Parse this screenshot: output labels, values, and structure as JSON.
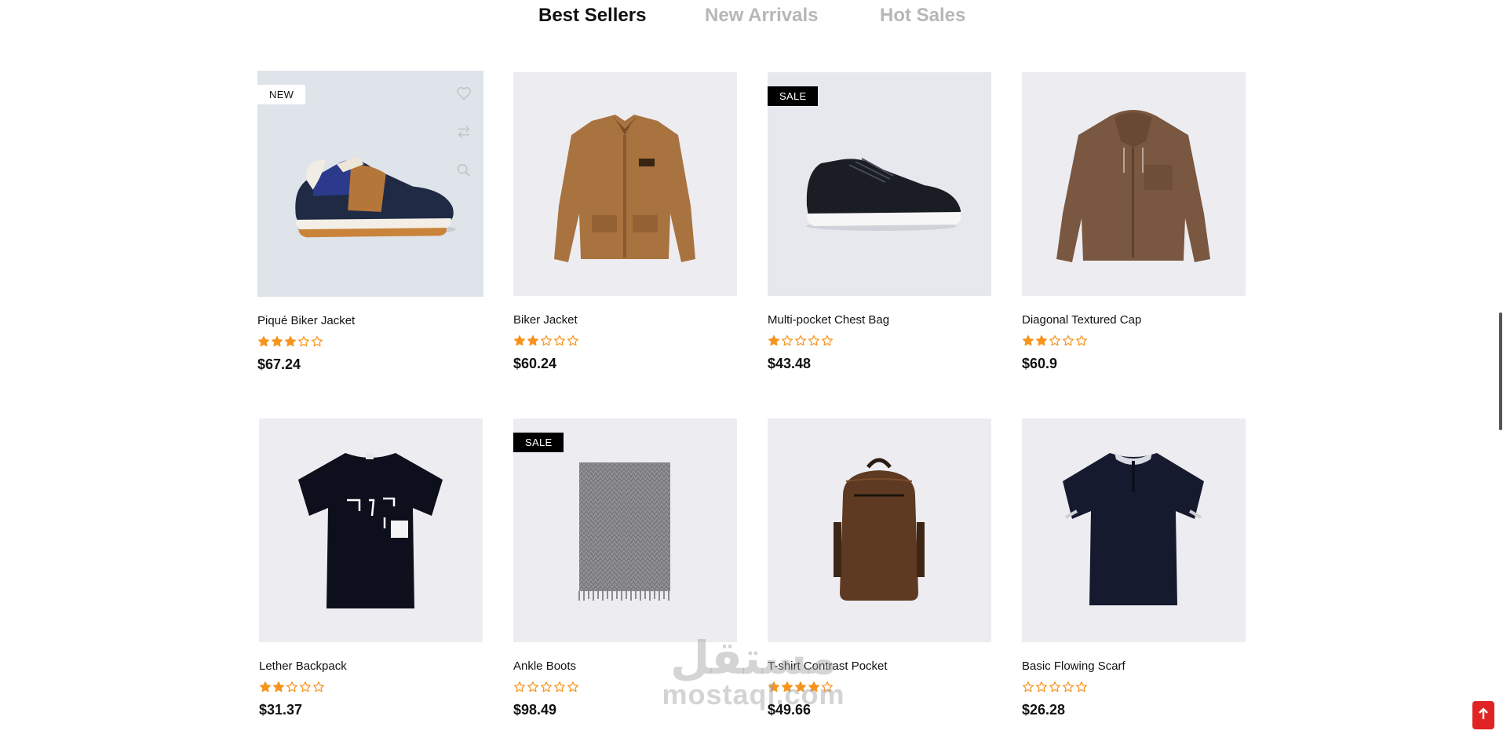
{
  "tabs": [
    {
      "label": "Best Sellers",
      "active": true
    },
    {
      "label": "New Arrivals",
      "active": false
    },
    {
      "label": "Hot Sales",
      "active": false
    }
  ],
  "products": [
    {
      "name": "Piqué Biker Jacket",
      "price": "$67.24",
      "rating": 3,
      "badge": "NEW",
      "image": "sneaker-navy-tan"
    },
    {
      "name": "Biker Jacket",
      "price": "$60.24",
      "rating": 2,
      "badge": "",
      "image": "jacket-tan"
    },
    {
      "name": "Multi-pocket Chest Bag",
      "price": "$43.48",
      "rating": 1,
      "badge": "SALE",
      "image": "sneaker-black"
    },
    {
      "name": "Diagonal Textured Cap",
      "price": "$60.9",
      "rating": 2,
      "badge": "",
      "image": "hoodie-shirt-brown"
    },
    {
      "name": "Lether Backpack",
      "price": "$31.37",
      "rating": 2,
      "badge": "",
      "image": "tshirt-black-print"
    },
    {
      "name": "Ankle Boots",
      "price": "$98.49",
      "rating": 0,
      "badge": "SALE",
      "image": "scarf-grey"
    },
    {
      "name": "T-shirt Contrast Pocket",
      "price": "$49.66",
      "rating": 4,
      "badge": "",
      "image": "backpack-brown"
    },
    {
      "name": "Basic Flowing Scarf",
      "price": "$26.28",
      "rating": 0,
      "badge": "",
      "image": "polo-navy"
    }
  ],
  "card_icons": [
    "heart-icon",
    "compare-icon",
    "search-icon"
  ],
  "watermark": {
    "arabic": "مستقل",
    "latin": "mostaql.com"
  },
  "scroll_top_icon": "arrow-up-icon",
  "colors": {
    "star": "#f7941d",
    "sale_badge": "#000000",
    "scroll_top": "#e02424",
    "card_bg": "#f2f2f6",
    "inactive_tab": "#b7b7b7"
  }
}
